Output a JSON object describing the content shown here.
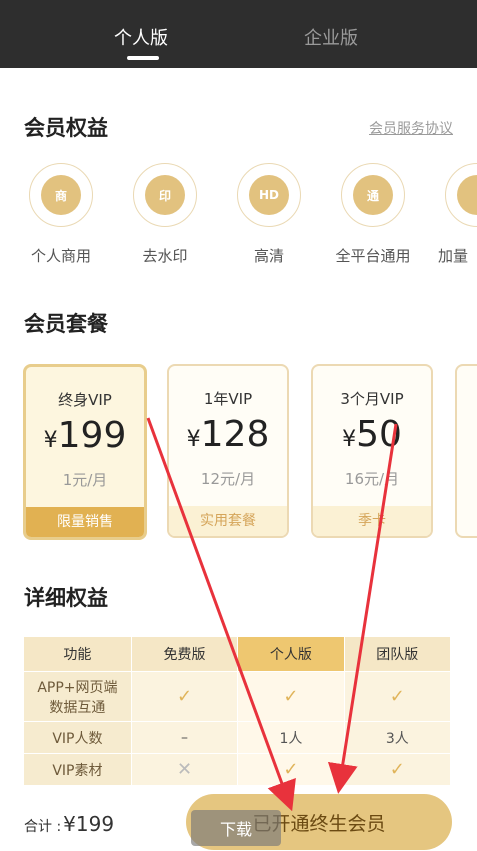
{
  "header": {
    "tabs": [
      {
        "label": "个人版"
      },
      {
        "label": "企业版"
      }
    ]
  },
  "benefits": {
    "title": "会员权益",
    "link": "会员服务协议",
    "items": [
      {
        "icon": "商",
        "label": "个人商用"
      },
      {
        "icon": "印",
        "label": "去水印"
      },
      {
        "icon": "HD",
        "label": "高清"
      },
      {
        "icon": "通",
        "label": "全平台通用"
      },
      {
        "icon": "",
        "label": "加量"
      }
    ]
  },
  "plans": {
    "title": "会员套餐",
    "items": [
      {
        "name": "终身VIP",
        "currency": "¥",
        "price": "199",
        "per": "1元/月",
        "tag": "限量销售"
      },
      {
        "name": "1年VIP",
        "currency": "¥",
        "price": "128",
        "per": "12元/月",
        "tag": "实用套餐"
      },
      {
        "name": "3个月VIP",
        "currency": "¥",
        "price": "50",
        "per": "16元/月",
        "tag": "季卡"
      }
    ]
  },
  "details": {
    "title": "详细权益",
    "headers": [
      "功能",
      "免费版",
      "个人版",
      "团队版"
    ],
    "rows": [
      {
        "feature_line1": "APP+网页端",
        "feature_line2": "数据互通",
        "free": "✓",
        "personal": "✓",
        "team": "✓"
      },
      {
        "feature": "VIP人数",
        "free": "–",
        "personal": "1人",
        "team": "3人"
      },
      {
        "feature": "VIP素材",
        "free": "✕",
        "personal": "✓",
        "team": "✓"
      }
    ]
  },
  "footer": {
    "total_label": "合计 :",
    "total_value": "¥199",
    "cta": "已开通终生会员",
    "download": "下载"
  },
  "colors": {
    "gold": "#e5c680",
    "dark_header": "#2e2e2e",
    "annotation_red": "#e8323c"
  }
}
